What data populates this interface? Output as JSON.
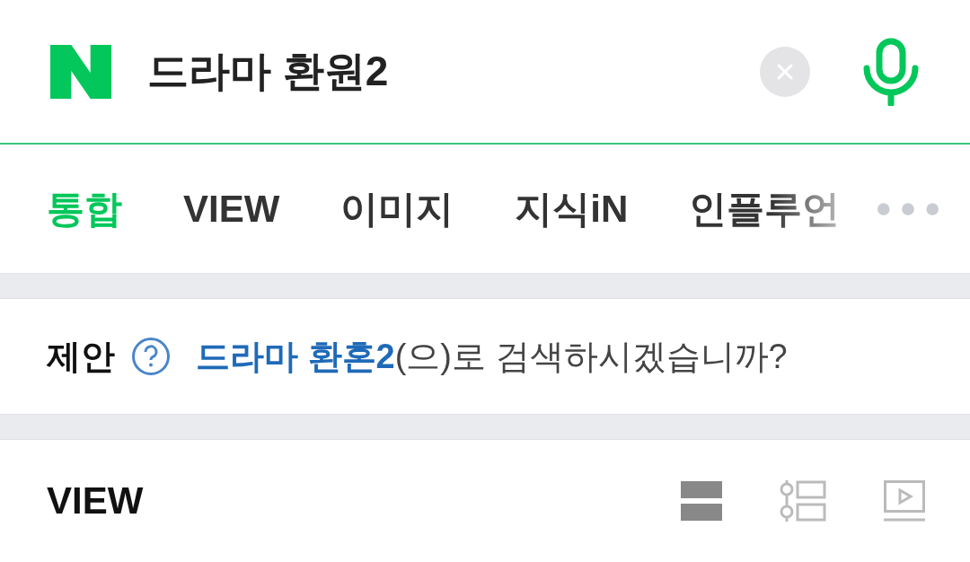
{
  "search": {
    "value": "드라마 환원2"
  },
  "tabs": [
    {
      "label": "통합",
      "selected": true
    },
    {
      "label": "VIEW",
      "selected": false
    },
    {
      "label": "이미지",
      "selected": false
    },
    {
      "label": "지식iN",
      "selected": false
    },
    {
      "label": "인플루언",
      "selected": false
    }
  ],
  "suggestion": {
    "label": "제안",
    "query": "드라마 환혼2",
    "rest": "(으)로 검색하시겠습니까?"
  },
  "section": {
    "title": "VIEW",
    "view_modes": [
      {
        "kind": "list",
        "selected": true
      },
      {
        "kind": "timeline",
        "selected": false
      },
      {
        "kind": "video",
        "selected": false
      }
    ]
  }
}
